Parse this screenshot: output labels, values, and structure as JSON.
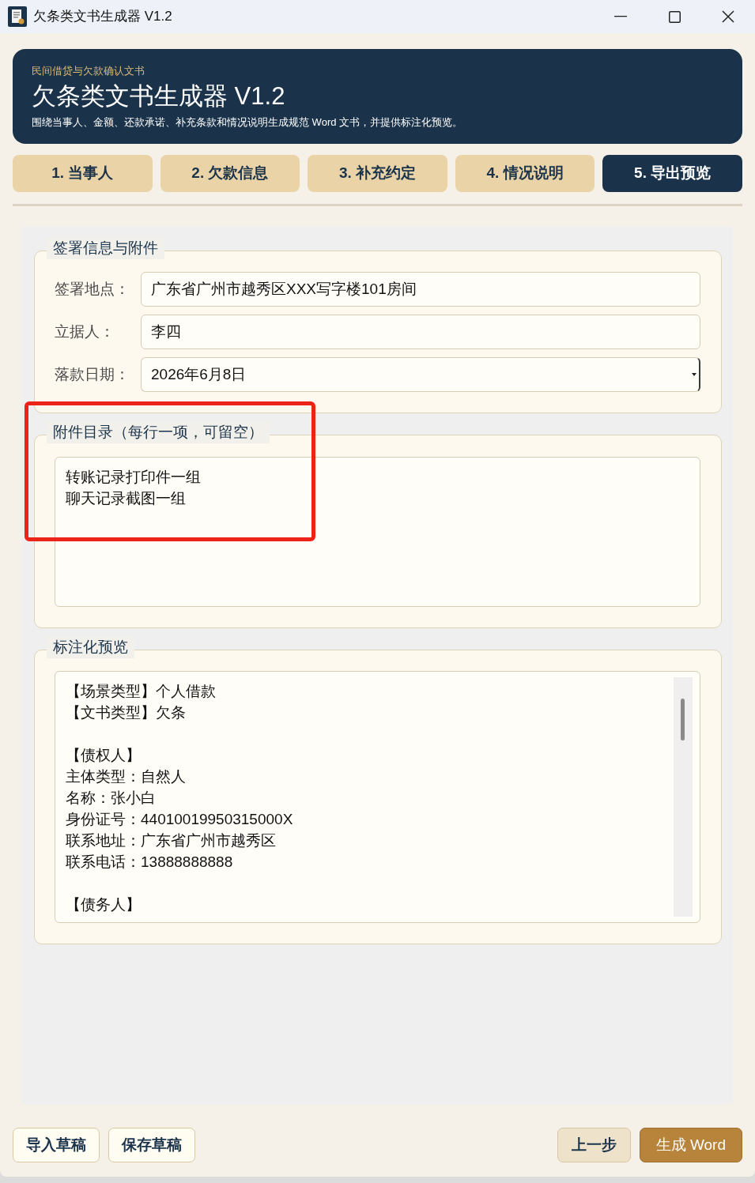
{
  "window": {
    "title": "欠条类文书生成器 V1.2"
  },
  "header": {
    "eyebrow": "民间借贷与欠款确认文书",
    "title": "欠条类文书生成器 V1.2",
    "description": "围绕当事人、金额、还款承诺、补充条款和情况说明生成规范 Word 文书，并提供标注化预览。"
  },
  "tabs": [
    {
      "label": "1. 当事人",
      "selected": false
    },
    {
      "label": "2. 欠款信息",
      "selected": false
    },
    {
      "label": "3. 补充约定",
      "selected": false
    },
    {
      "label": "4. 情况说明",
      "selected": false
    },
    {
      "label": "5. 导出预览",
      "selected": true
    }
  ],
  "sections": [
    {
      "kind": "form",
      "title": "签署信息与附件",
      "fields": [
        {
          "kind": "text",
          "label": "签署地点：",
          "value": "广东省广州市越秀区XXX写字楼101房间"
        },
        {
          "kind": "text",
          "label": "立据人：",
          "value": "李四"
        },
        {
          "kind": "date",
          "label": "落款日期：",
          "value": "2026年6月8日"
        }
      ]
    },
    {
      "kind": "textarea",
      "title": "附件目录（每行一项，可留空）",
      "lines": [
        "转账记录打印件一组",
        "聊天记录截图一组"
      ]
    },
    {
      "kind": "preview",
      "title": "标注化预览",
      "blocks": [
        {
          "lines": [
            "【场景类型】个人借款",
            "【文书类型】欠条"
          ]
        },
        {
          "lines": [
            "【债权人】",
            "主体类型：自然人",
            "名称：张小白",
            "身份证号：44010019950315000X",
            "联系地址：广东省广州市越秀区",
            "联系电话：13888888888"
          ]
        },
        {
          "lines": [
            "【债务人】"
          ]
        }
      ]
    }
  ],
  "overlay": {
    "kind": "highlight"
  },
  "footer": {
    "left_buttons": [
      {
        "label": "导入草稿",
        "kind": "outline"
      },
      {
        "label": "保存草稿",
        "kind": "outline"
      }
    ],
    "right_buttons": [
      {
        "label": "上一步",
        "kind": "secondary"
      },
      {
        "label": "生成 Word",
        "kind": "primary"
      }
    ]
  }
}
